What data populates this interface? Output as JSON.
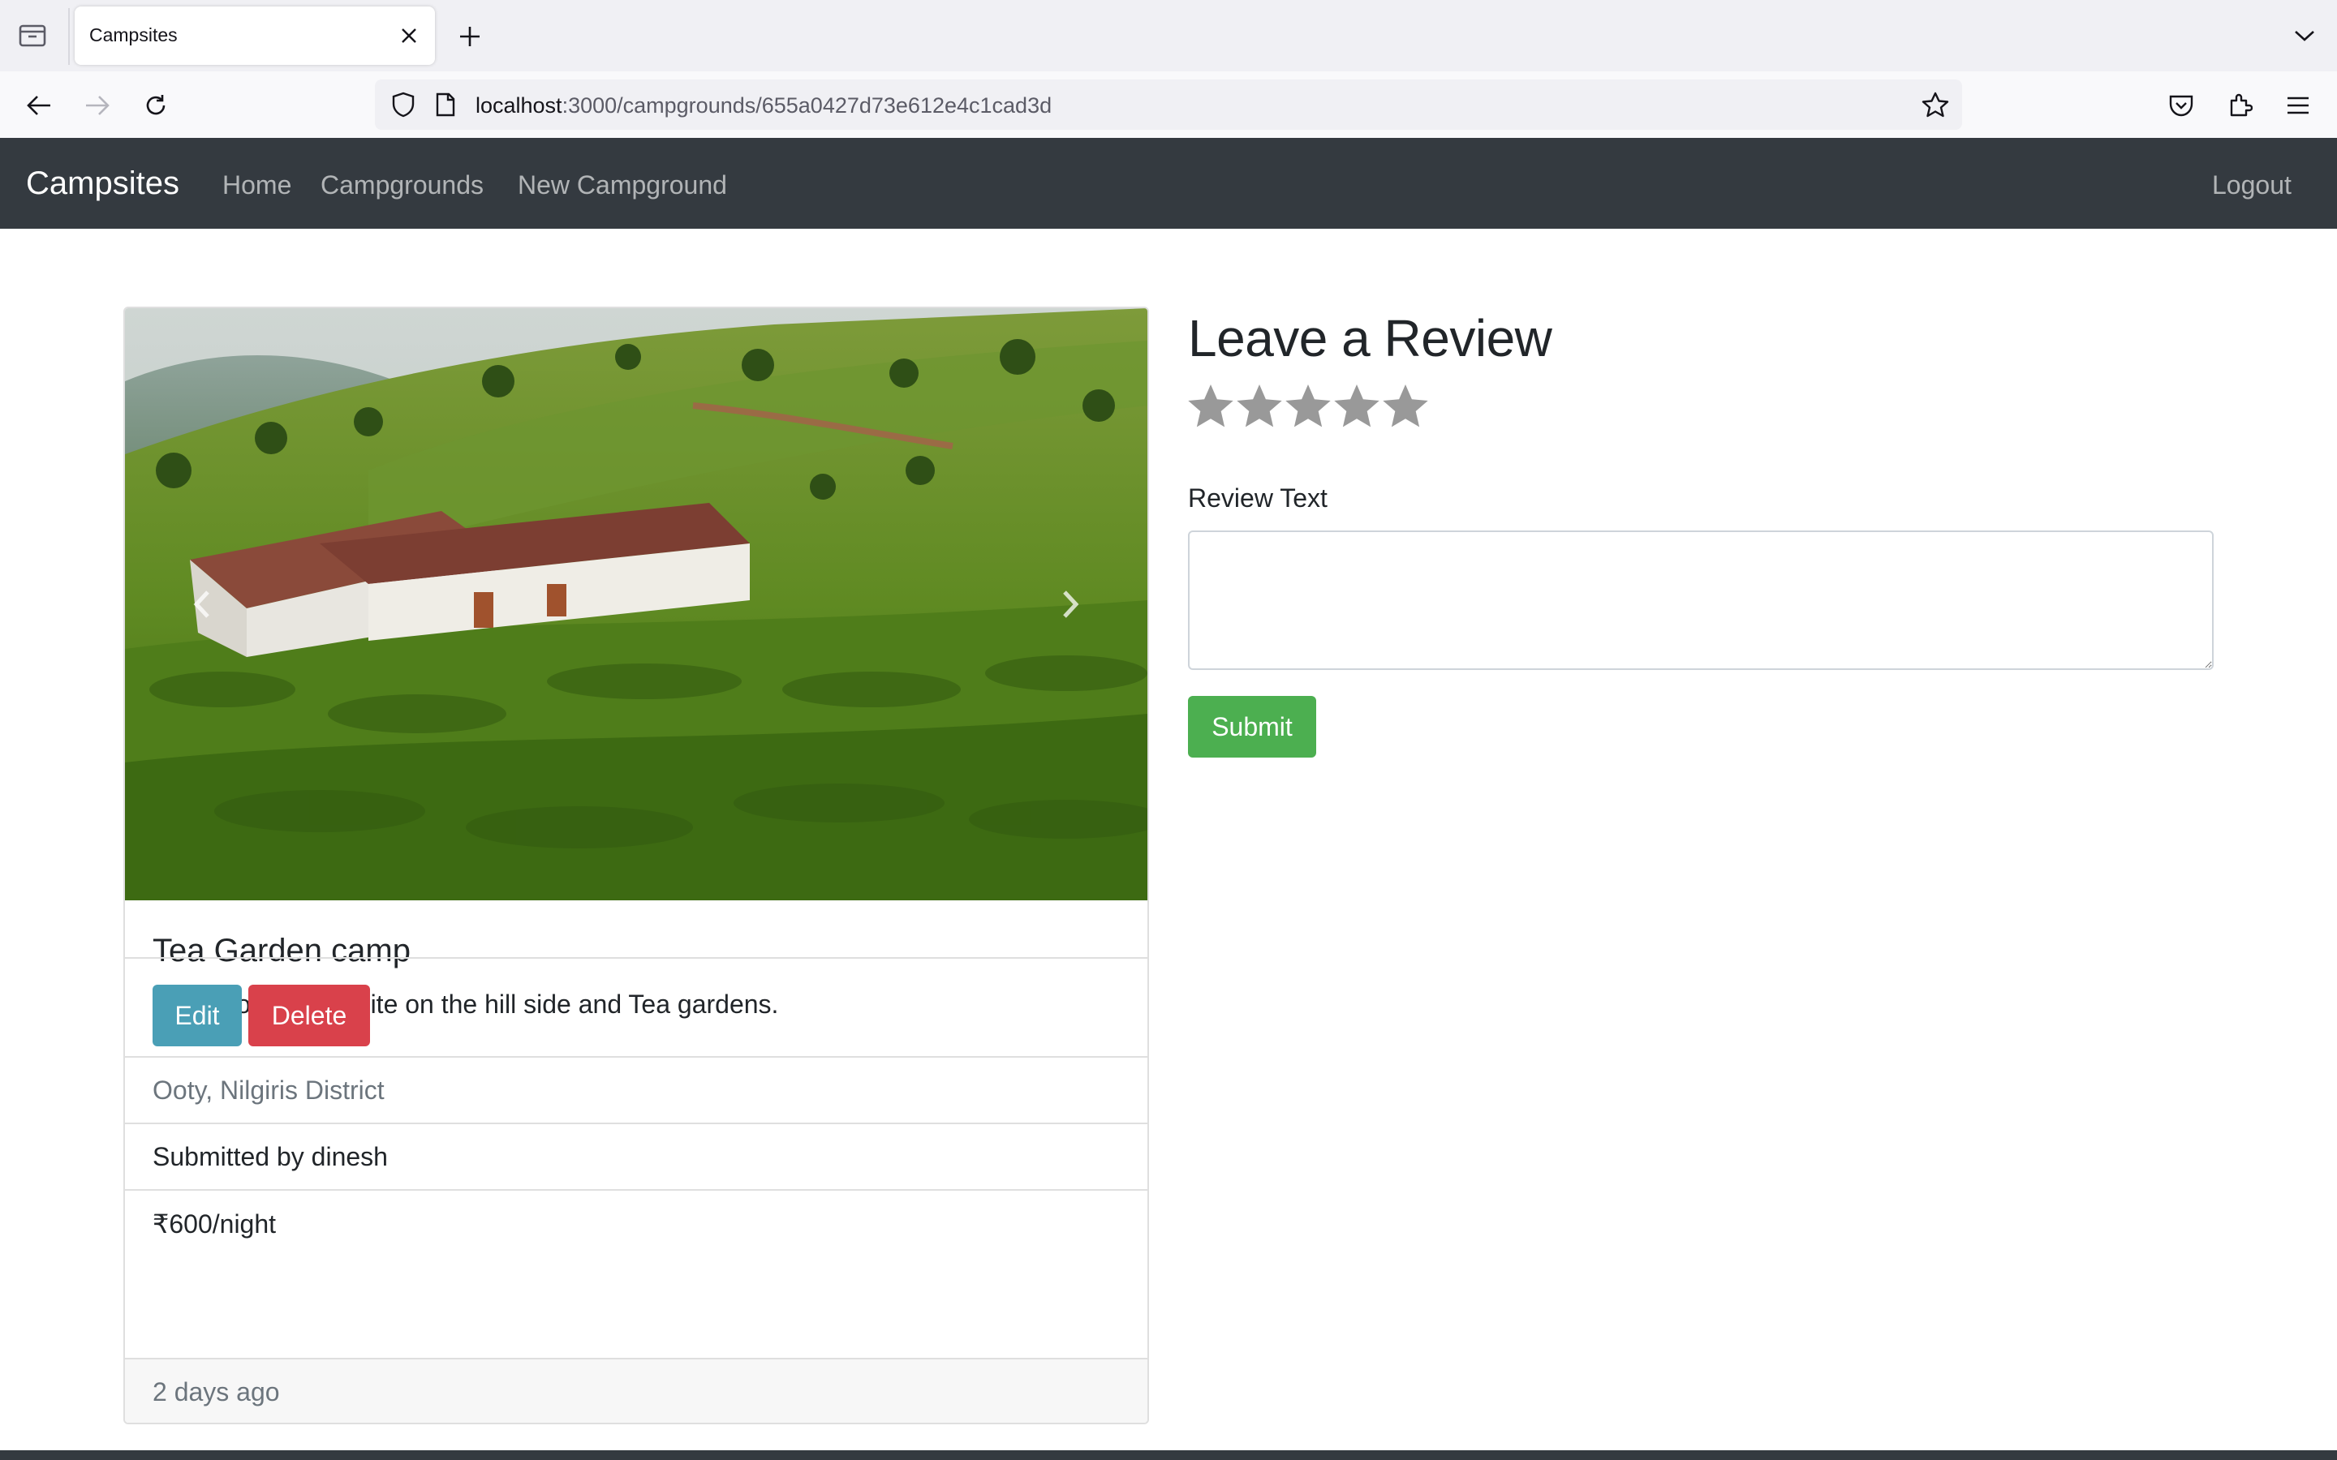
{
  "browser": {
    "tab_title": "Campsites",
    "url_host": "localhost",
    "url_path": ":3000/campgrounds/655a0427d73e612e4c1cad3d"
  },
  "navbar": {
    "brand": "Campsites",
    "links": [
      "Home",
      "Campgrounds",
      "New Campground"
    ],
    "logout": "Logout"
  },
  "campground": {
    "title": "Tea Garden camp",
    "description": "A awesome campsite on the hill side and Tea gardens.",
    "location": "Ooty, Nilgiris District",
    "submitted_by": "Submitted by dinesh",
    "price": "₹600/night",
    "edit_label": "Edit",
    "delete_label": "Delete",
    "posted": "2 days ago"
  },
  "review": {
    "heading": "Leave a Review",
    "rating_max": 5,
    "rating_selected": 0,
    "text_label": "Review Text",
    "text_value": "",
    "submit_label": "Submit"
  },
  "colors": {
    "navbar_bg": "#343a40",
    "edit_button": "#4a9fb6",
    "delete_button": "#d9414b",
    "submit_button": "#4caf50",
    "star_color": "#999999"
  }
}
